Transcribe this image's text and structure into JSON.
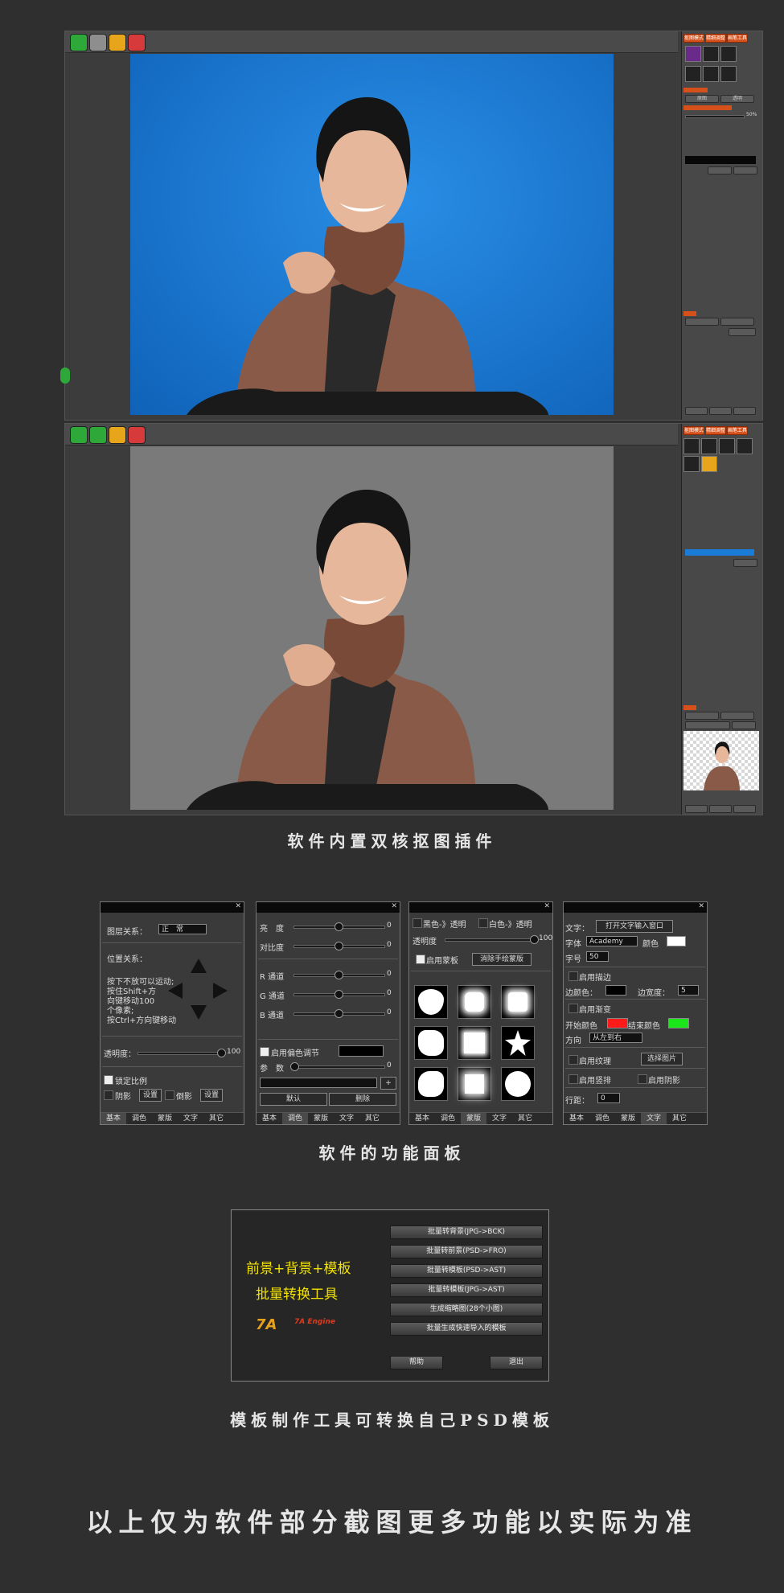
{
  "colors": {
    "accent_orange": "#d5501a",
    "canvas_blue": "#1a7cd6",
    "canvas_gray": "#7a7a7a",
    "caption_yellow": "#f2e200"
  },
  "window_top": {
    "right_tabs": [
      "抠图模式",
      "精细调整",
      "画笔工具"
    ],
    "bg_option_labels": [
      "原图",
      "透明"
    ],
    "value_50": "50%"
  },
  "window_bottom": {
    "right_tabs": [
      "抠图模式",
      "精细调整",
      "画笔工具"
    ]
  },
  "captions": {
    "c1": "软件内置双核抠图插件",
    "c2": "软件的功能面板",
    "c3": "模板制作工具可转换自己PSD模板",
    "c4": "以上仅为软件部分截图更多功能以实际为准"
  },
  "panel_basic": {
    "layer_relation_label": "图层关系：",
    "layer_relation_value": "正　常",
    "position_label": "位置关系：",
    "instructions": [
      "按下不放可以运动;",
      "按住Shift+方",
      "向键移动100",
      "个像素;",
      "按Ctrl+方向键移动"
    ],
    "opacity_label": "透明度：",
    "opacity_value": "100",
    "lock_ratio": "锁定比例",
    "shadow": "阴影",
    "settings": "设置",
    "reflection": "倒影",
    "settings2": "设置",
    "tabs": [
      "基本",
      "调色",
      "蒙版",
      "文字",
      "其它"
    ]
  },
  "panel_color": {
    "brightness": "亮　度",
    "contrast": "对比度",
    "r": "R 通道",
    "g": "G 通道",
    "b": "B 通道",
    "values": [
      "0",
      "0",
      "0",
      "0",
      "0"
    ],
    "enable_tint": "启用偏色调节",
    "params": "参　数",
    "params_value": "0",
    "add": "+",
    "default": "默认",
    "delete": "删除",
    "tabs": [
      "基本",
      "调色",
      "蒙版",
      "文字",
      "其它"
    ]
  },
  "panel_mask": {
    "black_transparent": "黑色-》透明",
    "white_transparent": "白色-》透明",
    "opacity": "透明度",
    "opacity_value": "100",
    "enable_mask": "启用蒙板",
    "clear_mask": "消除手绘蒙版",
    "tabs": [
      "基本",
      "调色",
      "蒙版",
      "文字",
      "其它"
    ]
  },
  "panel_text": {
    "text_label": "文字：",
    "open_window": "打开文字输入窗口",
    "font_label": "字体",
    "font_value": "Academy",
    "color_label": "颜色",
    "size_label": "字号",
    "size_value": "50",
    "enable_stroke": "启用描边",
    "stroke_color": "边颜色：",
    "stroke_width": "边宽度：",
    "stroke_width_value": "5",
    "enable_gradient": "启用渐变",
    "start_color": "开始颜色",
    "end_color": "结束颜色",
    "direction": "方向",
    "direction_value": "从左到右",
    "enable_texture": "启用纹理",
    "choose_image": "选择图片",
    "enable_vertical": "启用竖排",
    "enable_shadow": "启用阴影",
    "line_spacing": "行距：",
    "line_spacing_value": "0",
    "tabs": [
      "基本",
      "调色",
      "蒙版",
      "文字",
      "其它"
    ]
  },
  "batch_tool": {
    "title_line1": "前景+背景+模板",
    "title_line2": "批量转换工具",
    "logo_text": "7A Engine",
    "buttons": [
      "批量转背景(JPG->BCK)",
      "批量转前景(PSD->FRO)",
      "批量转模板(PSD->AST)",
      "批量转模板(JPG->AST)",
      "生成缩略图(28个小图)",
      "批量生成快速导入的模板"
    ],
    "help": "帮助",
    "exit": "退出"
  }
}
